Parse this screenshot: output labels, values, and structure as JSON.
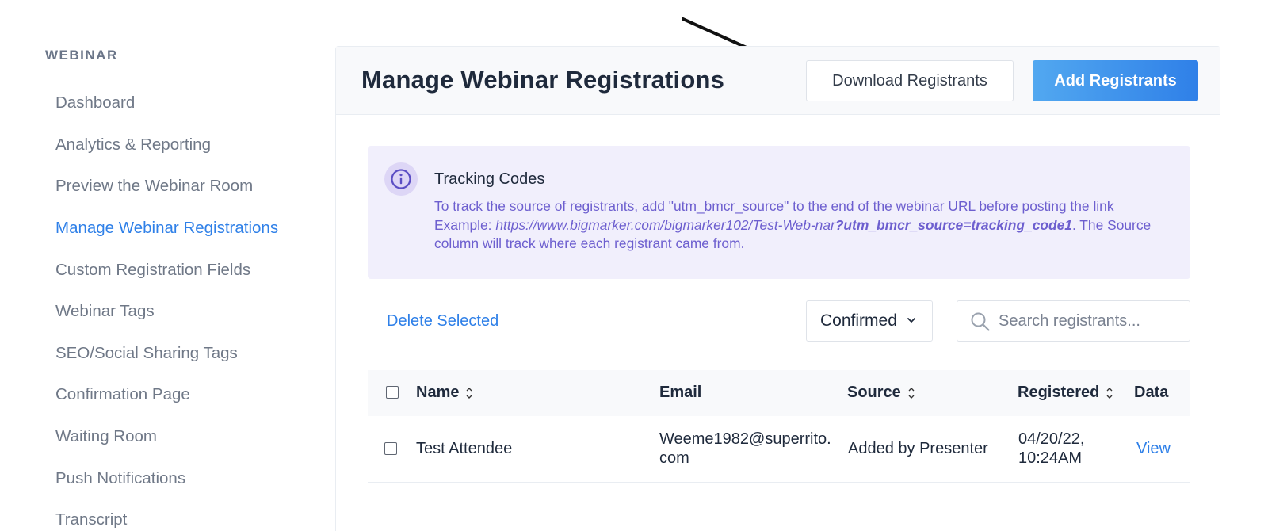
{
  "sidebar": {
    "heading": "WEBINAR",
    "items": [
      {
        "label": "Dashboard"
      },
      {
        "label": "Analytics & Reporting"
      },
      {
        "label": "Preview the Webinar Room"
      },
      {
        "label": "Manage Webinar Registrations"
      },
      {
        "label": "Custom Registration Fields"
      },
      {
        "label": "Webinar Tags"
      },
      {
        "label": "SEO/Social Sharing Tags"
      },
      {
        "label": "Confirmation Page"
      },
      {
        "label": "Waiting Room"
      },
      {
        "label": "Push Notifications"
      },
      {
        "label": "Transcript"
      }
    ],
    "active_index": 3
  },
  "header": {
    "title": "Manage Webinar Registrations",
    "download_label": "Download Registrants",
    "add_label": "Add Registrants"
  },
  "info": {
    "title": "Tracking Codes",
    "line1": "To track the source of registrants, add \"utm_bmcr_source\" to the end of the webinar URL before posting the link",
    "example_prefix": "Example: ",
    "example_url": "https://www.bigmarker.com/bigmarker102/Test-Web-nar",
    "example_param": "?utm_bmcr_source=tracking_code1",
    "line3": ". The Source column will track where each registrant came from."
  },
  "toolbar": {
    "delete_label": "Delete Selected",
    "filter_value": "Confirmed",
    "search_placeholder": "Search registrants..."
  },
  "table": {
    "columns": [
      "Name",
      "Email",
      "Source",
      "Registered",
      "Data"
    ],
    "rows": [
      {
        "name": "Test Attendee",
        "email_line1": "Weeme1982@superrito.",
        "email_line2": "com",
        "source": "Added by Presenter",
        "registered_line1": "04/20/22,",
        "registered_line2": "10:24AM",
        "data_link": "View"
      }
    ]
  },
  "colors": {
    "accent": "#2f80e8",
    "info_text": "#6d5fcf",
    "info_bg": "#f1effc"
  }
}
